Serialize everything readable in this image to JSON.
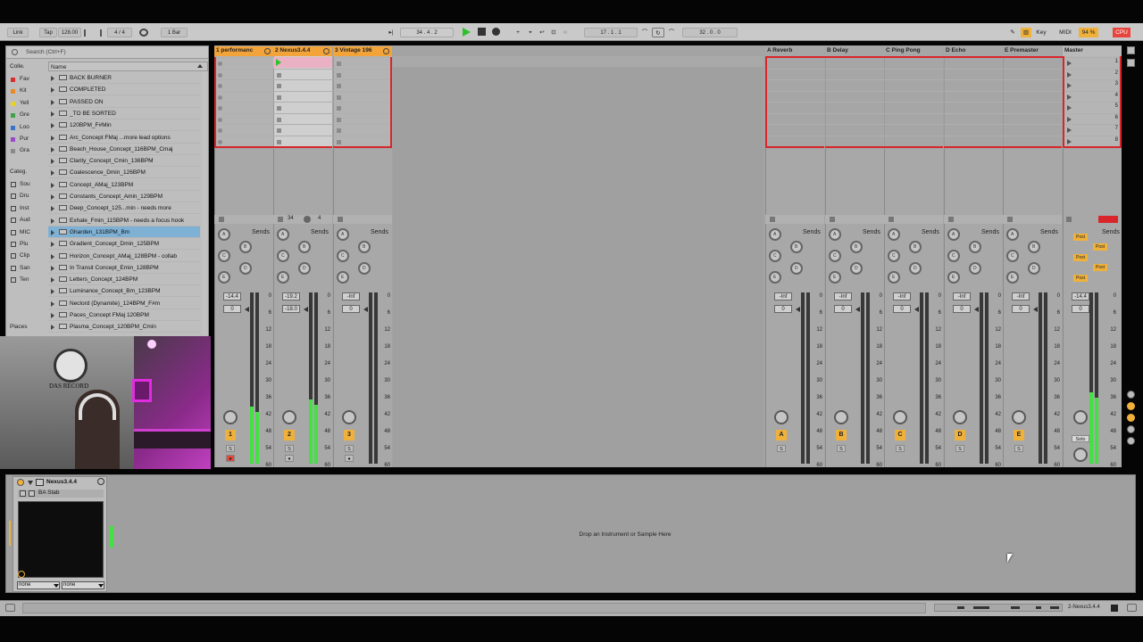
{
  "transport": {
    "link": "Link",
    "tap": "Tap",
    "tempo": "128.00",
    "sig": "4 / 4",
    "quant": "1 Bar",
    "pos": "34 .  4 .  2",
    "loop_start": "17 .  1 .  1",
    "loop_len": "32 .  0 .  0",
    "key": "Key",
    "midi": "MIDI",
    "cpu_pct": "94 %",
    "cpu": "CPU"
  },
  "browser": {
    "search_placeholder": "Search (Ctrl+F)",
    "collections_label": "Colle.",
    "name_header": "Name",
    "categories_label": "Categ.",
    "places_label": "Places",
    "collections": [
      {
        "label": "Fav",
        "color": "#d8302f"
      },
      {
        "label": "Kit",
        "color": "#e88a26"
      },
      {
        "label": "Yell",
        "color": "#e8d12a"
      },
      {
        "label": "Gre",
        "color": "#3fa34a"
      },
      {
        "label": "Loo",
        "color": "#3a73c9"
      },
      {
        "label": "Pur",
        "color": "#9a4ac9"
      },
      {
        "label": "Gra",
        "color": "#8a8a8a"
      }
    ],
    "categories": [
      "Sou",
      "Dru",
      "Inst",
      "Aud",
      "MIC",
      "Plu",
      "Clip",
      "San",
      "Ten"
    ],
    "items": [
      "BACK BURNER",
      "COMPLETED",
      "PASSED ON",
      "_TO BE SORTED",
      "120BPM_F#Min",
      "Arc_Concept FMaj ...more lead options",
      "Beach_House_Concept_116BPM_Cmaj",
      "Clarity_Concept_Cmin_136BPM",
      "Coalescence_Dmin_126BPM",
      "Concept_AMaj_123BPM",
      "Constants_Concept_Amin_129BPM",
      "Deep_Concept_125...min - needs more",
      "Exhale_Fmin_115BPM - needs a focus hook",
      "Gharden_131BPM_Bm",
      "Gradient_Concept_Dmin_125BPM",
      "Horizon_Concept_AMaj_128BPM - collab",
      "In Transit Concept_Emin_128BPM",
      "Letters_Concept_124BPM",
      "Luminance_Concept_Bm_123BPM",
      "Neclord (Dynamite)_124BPM_F#m",
      "Paces_Concept FMaj 120BPM",
      "Plasma_Concept_120BPM_Cmin"
    ],
    "selected_index": 13
  },
  "webcam": {
    "sign_text": "DAS RECORD"
  },
  "tracks": [
    {
      "name": "1 performanc",
      "color": "#f2a33a",
      "num": "1",
      "vol": "-14.4",
      "pan": "0"
    },
    {
      "name": "2 Nexus3.4.4",
      "color": "#f2a33a",
      "num": "2",
      "vol": "-19.2",
      "pan": "-18.0"
    },
    {
      "name": "3 Vintage 196",
      "color": "#f2a33a",
      "num": "3",
      "vol": "-Inf",
      "pan": "0"
    }
  ],
  "track2_bar": {
    "pos": "34",
    "beat": "4"
  },
  "returns": [
    {
      "name": "A Reverb",
      "letter": "A",
      "vol": "-Inf",
      "pan": "0"
    },
    {
      "name": "B Delay",
      "letter": "B",
      "vol": "-Inf",
      "pan": "0"
    },
    {
      "name": "C Ping Pong",
      "letter": "C",
      "vol": "-Inf",
      "pan": "0"
    },
    {
      "name": "D Echo",
      "letter": "D",
      "vol": "-Inf",
      "pan": "0"
    },
    {
      "name": "E Premaster",
      "letter": "E",
      "vol": "-Inf",
      "pan": "0"
    }
  ],
  "master": {
    "name": "Master",
    "vol": "-14.4",
    "pan": "0",
    "solo": "Solo",
    "scenes": [
      "1",
      "2",
      "3",
      "4",
      "5",
      "6",
      "7",
      "8"
    ]
  },
  "mixer": {
    "sends_label": "Sends",
    "post_label": "Post",
    "scale": [
      "0",
      "6",
      "12",
      "18",
      "24",
      "30",
      "36",
      "42",
      "48",
      "54",
      "60"
    ],
    "send_letters": [
      "A",
      "B",
      "C",
      "D",
      "E"
    ],
    "solo_letter": "S"
  },
  "device": {
    "track_name": "Nexus3.4.4",
    "preset_name": "BA Stab",
    "drop_text": "Drop an Instrument or Sample Here",
    "in_select": "none",
    "out_select": "none"
  },
  "status": {
    "track_label": "2-Nexus3.4.4"
  }
}
